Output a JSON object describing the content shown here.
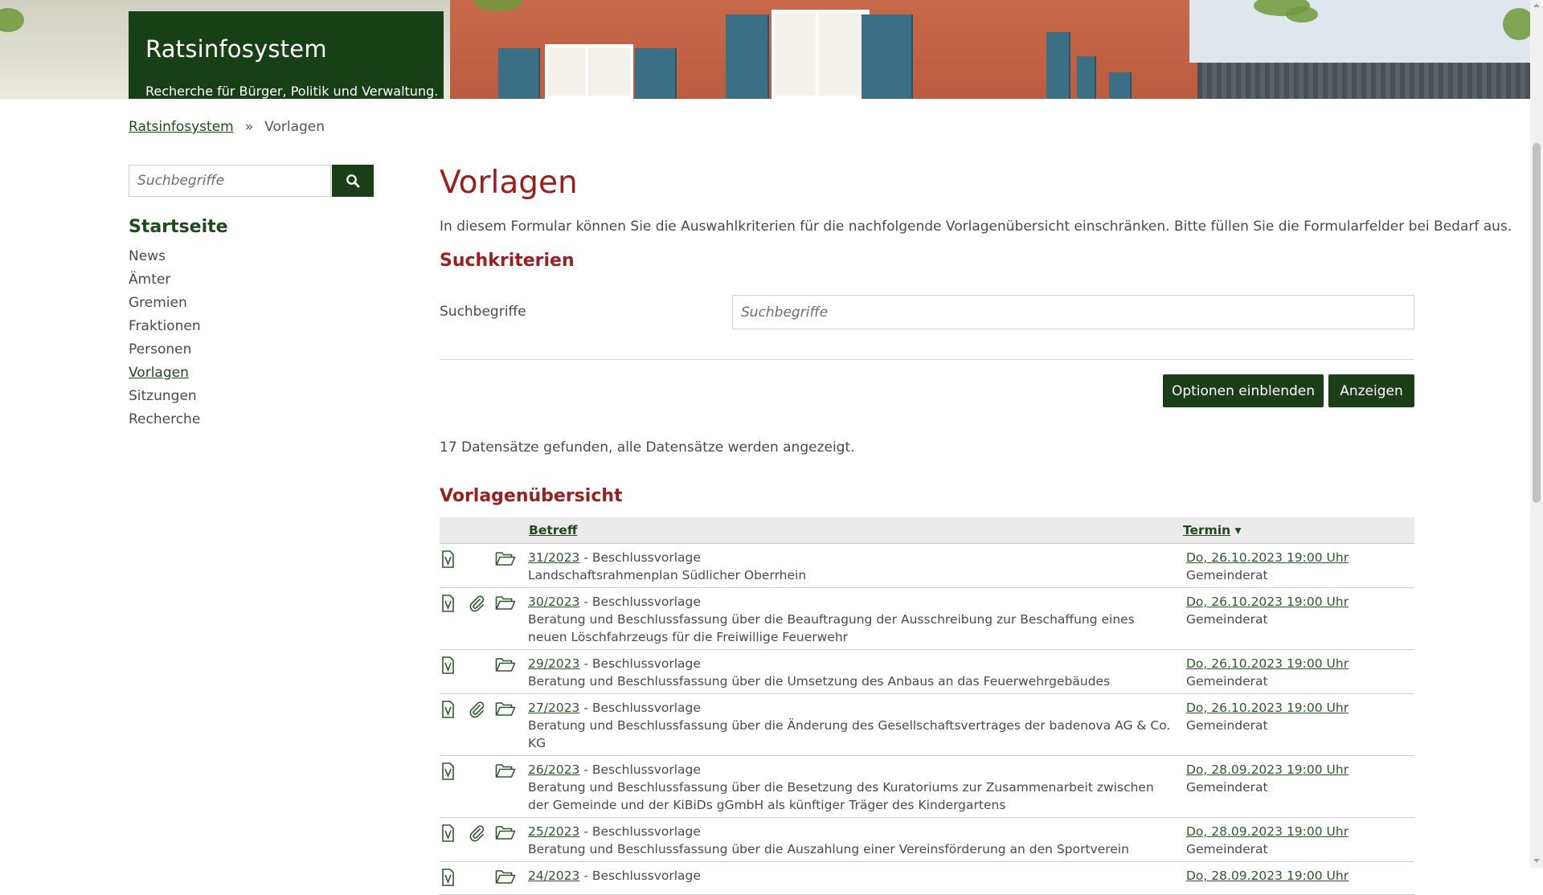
{
  "header": {
    "site_title": "Ratsinfosystem",
    "site_subtitle": "Recherche für Bürger, Politik und Verwaltung."
  },
  "breadcrumb": {
    "home": "Ratsinfosystem",
    "separator": "»",
    "current": "Vorlagen"
  },
  "sidebar": {
    "search_placeholder": "Suchbegriffe",
    "search_button_icon": "search-icon",
    "heading": "Startseite",
    "items": [
      {
        "label": "News"
      },
      {
        "label": "Ämter"
      },
      {
        "label": "Gremien"
      },
      {
        "label": "Fraktionen"
      },
      {
        "label": "Personen"
      },
      {
        "label": "Vorlagen"
      },
      {
        "label": "Sitzungen"
      },
      {
        "label": "Recherche"
      }
    ],
    "active_item": "Vorlagen"
  },
  "main": {
    "title": "Vorlagen",
    "intro": "In diesem Formular können Sie die Auswahlkriterien für die nachfolgende Vorlagenübersicht einschränken. Bitte füllen Sie die Formularfelder bei Bedarf aus.",
    "criteria_title": "Suchkriterien",
    "field_label": "Suchbegriffe",
    "field_placeholder": "Suchbegriffe",
    "btn_options": "Optionen einblenden",
    "btn_show": "Anzeigen",
    "count_text": "17 Datensätze gefunden, alle Datensätze werden angezeigt.",
    "overview_title": "Vorlagenübersicht"
  },
  "table": {
    "col_subject": "Betreff",
    "col_date": "Termin",
    "sort_indicator": "▾",
    "rows": [
      {
        "num": "31/2023",
        "type": " - Beschlussvorlage",
        "subject": "Landschaftsrahmenplan Südlicher Oberrhein",
        "date": "Do, 26.10.2023 19:00 Uhr",
        "body": "Gemeinderat",
        "attachment": false
      },
      {
        "num": "30/2023",
        "type": " - Beschlussvorlage",
        "subject": "Beratung und Beschlussfassung über die Beauftragung der Ausschreibung zur Beschaffung eines neuen Löschfahrzeugs für die Freiwillige Feuerwehr",
        "date": "Do, 26.10.2023 19:00 Uhr",
        "body": "Gemeinderat",
        "attachment": true
      },
      {
        "num": "29/2023",
        "type": " - Beschlussvorlage",
        "subject": "Beratung und Beschlussfassung über die Umsetzung des Anbaus an das Feuerwehrgebäudes",
        "date": "Do, 26.10.2023 19:00 Uhr",
        "body": "Gemeinderat",
        "attachment": false
      },
      {
        "num": "27/2023",
        "type": " - Beschlussvorlage",
        "subject": "Beratung und Beschlussfassung über die Änderung des Gesellschaftsvertrages der badenova AG & Co. KG",
        "date": "Do, 26.10.2023 19:00 Uhr",
        "body": "Gemeinderat",
        "attachment": true
      },
      {
        "num": "26/2023",
        "type": " - Beschlussvorlage",
        "subject": "Beratung und Beschlussfassung über die Besetzung des Kuratoriums zur Zusammenarbeit zwischen der Gemeinde und der KiBiDs gGmbH als künftiger Träger des Kindergartens",
        "date": "Do, 28.09.2023 19:00 Uhr",
        "body": "Gemeinderat",
        "attachment": false
      },
      {
        "num": "25/2023",
        "type": " - Beschlussvorlage",
        "subject": "Beratung und Beschlussfassung über die Auszahlung einer Vereinsförderung an den Sportverein",
        "date": "Do, 28.09.2023 19:00 Uhr",
        "body": "Gemeinderat",
        "attachment": true
      },
      {
        "num": "24/2023",
        "type": " - Beschlussvorlage",
        "subject": "",
        "date": "Do, 28.09.2023 19:00 Uhr",
        "body": "",
        "attachment": false
      }
    ]
  },
  "colors": {
    "brand_green": "#1a3f17",
    "heading_red": "#9b1f1c"
  }
}
